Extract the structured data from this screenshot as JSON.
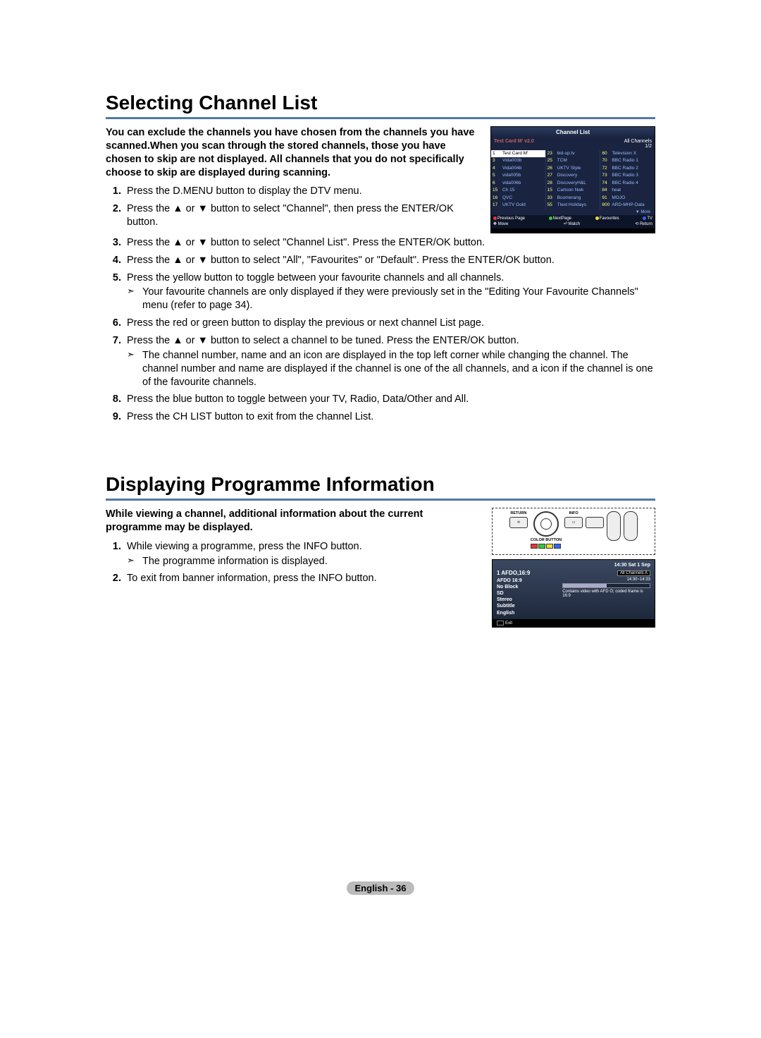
{
  "sections": {
    "channel_list": {
      "title": "Selecting Channel List",
      "intro": "You can exclude the channels you have chosen from the channels you have scanned.When you scan through the stored channels, those you have chosen to skip are not displayed. All channels that you do not specifically choose to skip are displayed during scanning.",
      "steps": [
        "Press the D.MENU button to display the DTV menu.",
        "Press the ▲ or ▼ button to select \"Channel\", then press the ENTER/OK button.",
        "Press the ▲ or ▼ button to select \"Channel List\". Press the ENTER/OK button.",
        "Press the ▲ or ▼ button to select \"All\", \"Favourites\" or \"Default\". Press the ENTER/OK button.",
        "Press the yellow button to toggle between your favourite channels and all channels.",
        "Press the red or green button to display the previous or next channel List page.",
        "Press the ▲ or ▼ button to select a channel to be tuned. Press the ENTER/OK button.",
        "Press the blue button to toggle between your TV, Radio, Data/Other and All.",
        "Press the CH LIST button to exit from the channel List."
      ],
      "step5_note": "Your favourite channels are only displayed if they were previously set in the \"Editing Your Favourite Channels\" menu (refer to page 34).",
      "step7_note": "The channel number, name and an icon are displayed in the top left corner while changing the channel. The channel number and name are displayed if the channel is one of the all channels, and a  icon if the channel is one of the favourite channels."
    },
    "prog_info": {
      "title": "Displaying Programme Information",
      "intro": "While viewing a channel, additional information about the current programme may be displayed.",
      "steps": [
        "While viewing a programme, press the INFO button.",
        "To exit from banner information, press the INFO button."
      ],
      "step1_note": "The programme information is displayed."
    }
  },
  "channel_list_fig": {
    "title": "Channel List",
    "subhead_left": "Test Card M' v2.0",
    "subhead_right_top": "All Channels",
    "subhead_right_bot": "1/2",
    "cols": [
      [
        {
          "n": "1",
          "name": "Test Card M'",
          "sel": true
        },
        {
          "n": "3",
          "name": "Vida003b"
        },
        {
          "n": "4",
          "name": "Vida004b"
        },
        {
          "n": "5",
          "name": "vida005b"
        },
        {
          "n": "6",
          "name": "vida006b"
        },
        {
          "n": "15",
          "name": "Ch 15"
        },
        {
          "n": "16",
          "name": "QVC"
        },
        {
          "n": "17",
          "name": "UKTV Gold"
        }
      ],
      [
        {
          "n": "23",
          "name": "bid-up.tv"
        },
        {
          "n": "25",
          "name": "TCM"
        },
        {
          "n": "26",
          "name": "UKTV Style"
        },
        {
          "n": "27",
          "name": "Discovery"
        },
        {
          "n": "28",
          "name": "DiscoveryH&L"
        },
        {
          "n": "15",
          "name": "Cartoon Nwk"
        },
        {
          "n": "33",
          "name": "Boomerang"
        },
        {
          "n": "55",
          "name": "Ttext Holidays"
        }
      ],
      [
        {
          "n": "60",
          "name": "Television X"
        },
        {
          "n": "70",
          "name": "BBC Radio 1"
        },
        {
          "n": "72",
          "name": "BBC Radio 2"
        },
        {
          "n": "73",
          "name": "BBC Radio 3"
        },
        {
          "n": "74",
          "name": "BBC Radio 4"
        },
        {
          "n": "84",
          "name": "heat"
        },
        {
          "n": "91",
          "name": "MOJO"
        },
        {
          "n": "800",
          "name": "ARD-MHP-Data"
        }
      ]
    ],
    "more": "▼ More",
    "footer": {
      "prev": "Previous Page",
      "next": "NextPage",
      "fav": "Favourites",
      "tv": "TV",
      "move": "Move",
      "watch": "Watch",
      "ret": "Return"
    }
  },
  "remote_fig": {
    "return": "RETURN",
    "info": "INFO",
    "color_button": "COLOR BUTTON"
  },
  "info_panel": {
    "time": "14:30 Sat 1 Sep",
    "channel": "1 AFDO,16:9",
    "badge": "All Channels   A",
    "prog_time": "14:30~14:33",
    "meta": [
      "AFDO 16:9",
      "No Block",
      "SD",
      "Stereo",
      "Subtitle",
      "English"
    ],
    "desc": "Contains video with AFD O; coded frame is 16:9",
    "exit": "Exit"
  },
  "footer": "English - 36"
}
